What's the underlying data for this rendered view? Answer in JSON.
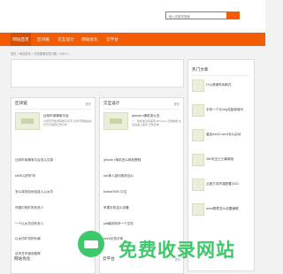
{
  "header": {
    "search_placeholder": "输入关键词搜索"
  },
  "nav": {
    "items": [
      "网站首页",
      "区块链",
      "交互设计",
      "网站优化",
      "云平台"
    ]
  },
  "breadcrumb": "首页 > 网站优化 > 浏览器兼容性问题 > 为什么...",
  "blocks": {
    "blockchain": {
      "title": "区块链",
      "more": "更多",
      "featured_title": "比特币用哪家平台",
      "featured_desc": "比特币开放源码数字货币 比特币网络由多方节点保持记录分布",
      "list": [
        "比特币用哪家平台怎么交易",
        "eth可以挖矿吗",
        "怎么将钱包地址接入以太坊",
        "币圈中的矿机有多少",
        "一个以太坊还有多少",
        "以太坊矿机的价格",
        "法币兑币使用推荐"
      ]
    },
    "interaction": {
      "title": "交互设计",
      "more": "更多",
      "featured_title": "iphone x换机怎么去",
      "featured_desc": "一、换机前注意事项 iPhoneX 迁移数据 在旧设备上备份 迁移完成",
      "list": [
        "iphone x换机怎么换机教程",
        "win换人如何换机怎么",
        "foobar2000 中文",
        "苹果手机这么设置",
        "pdf编页码好一个文件",
        "word文档字体"
      ]
    },
    "hot": {
      "title": "热门文章",
      "list": [
        "什么是硬件和软件",
        "手机一个月10g流量够用吗",
        "重启win10 win4怎么启动",
        "360安全卫士最新版",
        "云团方向终端配置2022",
        "word框框怎么设置编辑"
      ]
    },
    "optimize": {
      "title": "网站优化"
    },
    "cloud": {
      "title": "云平台",
      "more": "更多"
    }
  },
  "watermark": {
    "text": "免费收录网站"
  },
  "colors": {
    "accent": "#f25c05",
    "watermark": "#3cc96a"
  }
}
